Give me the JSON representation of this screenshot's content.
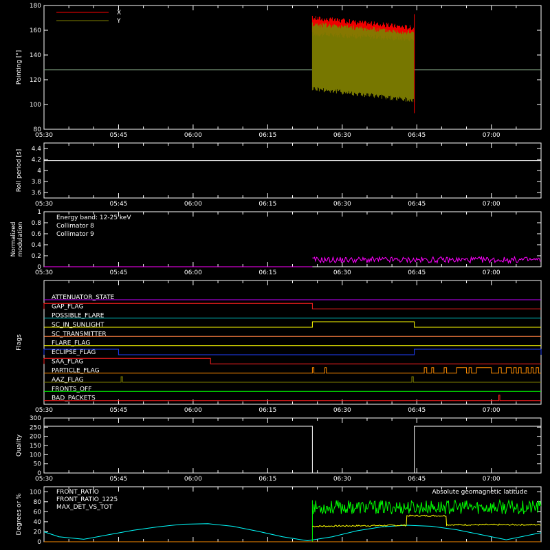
{
  "chart_data": [
    {
      "type": "line",
      "ylabel": "Pointing [\"]",
      "ylim": [
        80,
        180
      ],
      "yticks": [
        80,
        100,
        120,
        140,
        160,
        180
      ],
      "xlim": [
        "05:30",
        "07:10"
      ],
      "xticks": [
        "05:30",
        "05:45",
        "06:00",
        "06:15",
        "06:30",
        "06:45",
        "07:00"
      ],
      "legend": [
        {
          "name": "X",
          "color": "#ff0000"
        },
        {
          "name": "Y",
          "color": "#808000"
        }
      ],
      "series": [
        {
          "name": "X",
          "color": "#ff0000",
          "x": [
            "05:30",
            "06:24",
            "06:24",
            "06:44.5",
            "06:44.5",
            "07:10"
          ],
          "y_low": [
            128,
            128,
            157,
            153,
            128,
            128
          ],
          "y_high": [
            128,
            128,
            170,
            162,
            128,
            128
          ]
        },
        {
          "name": "Y",
          "color": "#808000",
          "x": [
            "05:30",
            "06:24",
            "06:24",
            "06:44.5",
            "06:44.5",
            "07:10"
          ],
          "y_low": [
            128,
            128,
            113,
            103,
            128,
            128
          ],
          "y_high": [
            128,
            128,
            165,
            158,
            128,
            128
          ]
        }
      ],
      "spikes": [
        {
          "x": "06:44.5",
          "y_low": 93,
          "y_high": 173
        }
      ]
    },
    {
      "type": "line",
      "ylabel": "Roll period [s]",
      "ylim": [
        3.5,
        4.5
      ],
      "yticks": [
        3.6,
        3.8,
        4.0,
        4.2,
        4.4
      ],
      "xticks": [
        "05:30",
        "05:45",
        "06:00",
        "06:15",
        "06:30",
        "06:45",
        "07:00"
      ],
      "series": [
        {
          "color": "#ffffff",
          "x": [
            "05:30",
            "07:10"
          ],
          "y": [
            4.18,
            4.18
          ]
        }
      ]
    },
    {
      "type": "line",
      "ylabel": "Normalized modulation",
      "ylim": [
        0,
        1.0
      ],
      "yticks": [
        0.0,
        0.2,
        0.4,
        0.6,
        0.8,
        1.0
      ],
      "xticks": [
        "05:30",
        "05:45",
        "06:00",
        "06:15",
        "06:30",
        "06:45",
        "07:00"
      ],
      "annotations": [
        {
          "text": "Energy band: 12-25 keV",
          "color": "#ffffff"
        },
        {
          "text": "Collimator 8",
          "color": "#00ffff"
        },
        {
          "text": "Collimator 9",
          "color": "#ff00ff"
        }
      ],
      "series": [
        {
          "name": "Collimator 9",
          "color": "#ff00ff",
          "x": [
            "05:30",
            "06:24",
            "06:24",
            "07:10"
          ],
          "y_low": [
            0.0,
            0.0,
            0.07,
            0.07
          ],
          "y_high": [
            0.0,
            0.0,
            0.18,
            0.18
          ]
        }
      ]
    },
    {
      "type": "line",
      "ylabel": "Flags",
      "xticks": [
        "05:30",
        "05:45",
        "06:00",
        "06:15",
        "06:30",
        "06:45",
        "07:00"
      ],
      "flags": [
        {
          "name": "ATTENUATOR_STATE",
          "color": "#c000ff",
          "high": []
        },
        {
          "name": "GAP_FLAG",
          "color": "#ff2020",
          "high": [
            [
              "05:30",
              "06:24"
            ]
          ]
        },
        {
          "name": "POSSIBLE_FLARE",
          "color": "#00c0c0",
          "high": []
        },
        {
          "name": "SC_IN_SUNLIGHT",
          "color": "#ffff00",
          "high": [
            [
              "06:24",
              "06:44.5"
            ]
          ]
        },
        {
          "name": "SC_TRANSMITTER",
          "color": "#ff8040",
          "high": []
        },
        {
          "name": "FLARE_FLAG",
          "color": "#ffff00",
          "high": []
        },
        {
          "name": "ECLIPSE_FLAG",
          "color": "#2040ff",
          "high": [
            [
              "05:30",
              "05:45"
            ],
            [
              "06:44.5",
              "07:10"
            ]
          ]
        },
        {
          "name": "SAA_FLAG",
          "color": "#ff2020",
          "high": [
            [
              "05:30",
              "06:03.5"
            ]
          ]
        },
        {
          "name": "PARTICLE_FLAG",
          "color": "#ff8c00",
          "high": [
            [
              "06:24",
              "06:24.3"
            ],
            [
              "06:26.5",
              "06:26.8"
            ],
            [
              "06:46.5",
              "06:47"
            ],
            [
              "06:48",
              "06:48.4"
            ],
            [
              "06:50.5",
              "06:51"
            ],
            [
              "06:53",
              "06:55"
            ],
            [
              "06:55.5",
              "06:56"
            ],
            [
              "06:57",
              "07:00"
            ],
            [
              "07:01.5",
              "07:02"
            ],
            [
              "07:03",
              "07:04"
            ],
            [
              "07:04.5",
              "07:05"
            ],
            [
              "07:05.5",
              "07:06"
            ],
            [
              "07:07",
              "07:07.4"
            ],
            [
              "07:08",
              "07:08.4"
            ],
            [
              "07:09",
              "07:09.5"
            ]
          ]
        },
        {
          "name": "AAZ_FLAG",
          "color": "#808000",
          "high": [
            [
              "05:45.5",
              "05:45.8"
            ],
            [
              "06:44",
              "06:44.3"
            ]
          ]
        },
        {
          "name": "FRONTS_OFF",
          "color": "#00ff00",
          "high": []
        },
        {
          "name": "BAD_PACKETS",
          "color": "#ff2020",
          "high": [
            [
              "07:01.5",
              "07:01.7"
            ]
          ]
        }
      ]
    },
    {
      "type": "line",
      "ylabel": "Quality",
      "ylim": [
        0,
        300
      ],
      "yticks": [
        0,
        50,
        100,
        150,
        200,
        250,
        300
      ],
      "xticks": [
        "05:30",
        "05:45",
        "06:00",
        "06:15",
        "06:30",
        "06:45",
        "07:00"
      ],
      "series": [
        {
          "color": "#ffffff",
          "x": [
            "05:30",
            "06:24",
            "06:24",
            "06:44.5",
            "06:44.5",
            "07:10"
          ],
          "y": [
            255,
            255,
            0,
            0,
            255,
            255
          ]
        }
      ]
    },
    {
      "type": "line",
      "ylabel": "Degrees or %",
      "ylim": [
        0,
        110
      ],
      "yticks": [
        0,
        20,
        40,
        60,
        80,
        100
      ],
      "legend": [
        {
          "name": "FRONT_RATIO",
          "color": "#ffff00"
        },
        {
          "name": "FRONT_RATIO_1225",
          "color": "#00ff00"
        },
        {
          "name": "MAX_DET_VS_TOT",
          "color": "#ff8c00"
        },
        {
          "name": "Absolute geomagnetic latitude",
          "color": "#00ffff"
        }
      ],
      "series": [
        {
          "name": "Absolute geomagnetic latitude",
          "color": "#00ffff",
          "x": [
            "05:30",
            "05:33",
            "05:38",
            "05:43",
            "05:48",
            "05:53",
            "05:58",
            "06:03",
            "06:08",
            "06:13",
            "06:18",
            "06:23",
            "06:28",
            "06:33",
            "06:38",
            "06:43",
            "06:48",
            "06:53",
            "06:58",
            "07:03",
            "07:08",
            "07:10"
          ],
          "y": [
            20,
            10,
            5,
            14,
            23,
            30,
            35,
            36,
            31,
            21,
            10,
            2,
            10,
            22,
            30,
            33,
            31,
            24,
            14,
            4,
            14,
            18
          ]
        },
        {
          "name": "FRONT_RATIO_1225",
          "color": "#00ff00",
          "x": [
            "06:24",
            "06:24",
            "07:10"
          ],
          "y_low": [
            0,
            55,
            55
          ],
          "y_high": [
            0,
            83,
            83
          ]
        },
        {
          "name": "FRONT_RATIO",
          "color": "#ffff00",
          "x": [
            "06:24",
            "06:24",
            "06:43",
            "06:43",
            "06:51",
            "06:51",
            "07:10"
          ],
          "y": [
            0,
            31,
            33,
            52,
            52,
            34,
            34
          ]
        },
        {
          "name": "MAX_DET_VS_TOT",
          "color": "#ff8c00",
          "x": [
            "05:30",
            "07:10"
          ],
          "y": [
            0,
            0
          ]
        }
      ]
    }
  ]
}
